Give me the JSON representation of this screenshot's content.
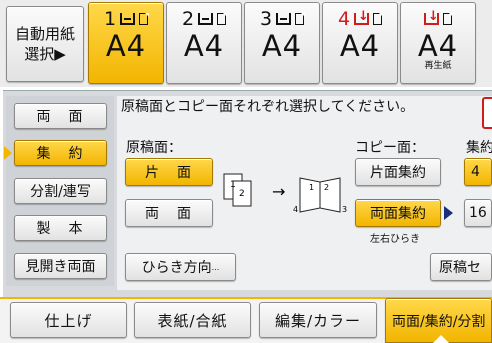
{
  "trays": {
    "auto_select": {
      "line1": "自動用紙",
      "line2": "選択▶"
    },
    "items": [
      {
        "number": "1",
        "size": "A4",
        "sub": "",
        "selected": true
      },
      {
        "number": "2",
        "size": "A4",
        "sub": "",
        "selected": false
      },
      {
        "number": "3",
        "size": "A4",
        "sub": "",
        "selected": false
      },
      {
        "number": "4",
        "size": "A4",
        "sub": "",
        "selected": false
      },
      {
        "number": "",
        "size": "A4",
        "sub": "再生紙",
        "selected": false
      }
    ]
  },
  "left_menu": {
    "items": [
      {
        "label": "両　面",
        "selected": false
      },
      {
        "label": "集　約",
        "selected": true
      },
      {
        "label": "分割/連写",
        "selected": false
      },
      {
        "label": "製　本",
        "selected": false
      },
      {
        "label": "見開き両面",
        "selected": false
      }
    ]
  },
  "content": {
    "instruction": "原稿面とコピー面それぞれ選択してください。",
    "original_heading": "原稿面：",
    "original_options": [
      "片　面",
      "両　面"
    ],
    "copy_heading": "コピー面：",
    "copy_options": [
      "片面集約",
      "両面集約"
    ],
    "copy_note": "左右ひらき",
    "aggregate_heading": "集約",
    "aggregate_value": "4",
    "aggregate_next": "16",
    "open_direction_label": "ひらき方向",
    "original_set_label": "原稿セ",
    "diagram_labels": [
      "1",
      "2",
      "4",
      "1",
      "2",
      "3"
    ]
  },
  "tabs": [
    {
      "label": "仕上げ",
      "active": false
    },
    {
      "label": "表紙/合紙",
      "active": false
    },
    {
      "label": "編集/カラー",
      "active": false
    },
    {
      "label": "両面/集約/分割",
      "active": true
    }
  ],
  "colors": {
    "accent_yellow": "#f2b500",
    "warning_red": "#d21b1b",
    "navy_arrow": "#1a2f7a"
  },
  "icons": [
    "tray-icon",
    "paper-icon",
    "tray-empty-icon",
    "right-arrow-icon",
    "triangle-right-icon"
  ]
}
